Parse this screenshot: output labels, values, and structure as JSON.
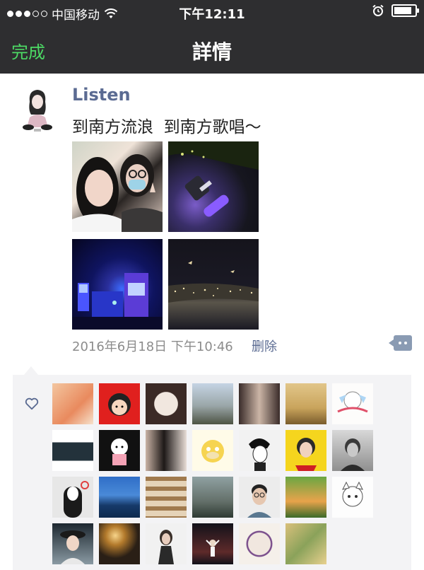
{
  "status_bar": {
    "carrier": "中国移动",
    "time": "下午12:11",
    "signal_dots_filled": 3,
    "signal_dots_total": 5,
    "battery_level": 0.85
  },
  "nav": {
    "done_label": "完成",
    "title": "詳情"
  },
  "post": {
    "username": "Listen",
    "text": "到南方流浪  到南方歌唱～",
    "date": "2016年6月18日 下午10:46",
    "delete_label": "删除",
    "photos": [
      "selfie-photo",
      "concert-lightstick-photo",
      "concert-stage-photo",
      "night-crowd-photo"
    ]
  },
  "likes": {
    "icon": "heart-icon",
    "avatars": [
      "like-avatar-1",
      "like-avatar-2",
      "like-avatar-3",
      "like-avatar-4",
      "like-avatar-5",
      "like-avatar-6",
      "like-avatar-7",
      "like-avatar-8",
      "like-avatar-9",
      "like-avatar-10",
      "like-avatar-11",
      "like-avatar-12",
      "like-avatar-13",
      "like-avatar-14",
      "like-avatar-15",
      "like-avatar-16",
      "like-avatar-17",
      "like-avatar-18",
      "like-avatar-19",
      "like-avatar-20",
      "like-avatar-21",
      "like-avatar-22",
      "like-avatar-23",
      "like-avatar-24",
      "like-avatar-25",
      "like-avatar-26",
      "like-avatar-27"
    ]
  },
  "colors": {
    "bar_bg": "#2e2e30",
    "accent_green": "#4cd964",
    "link_blue": "#5b6b92",
    "panel_bg": "#f3f3f5"
  }
}
